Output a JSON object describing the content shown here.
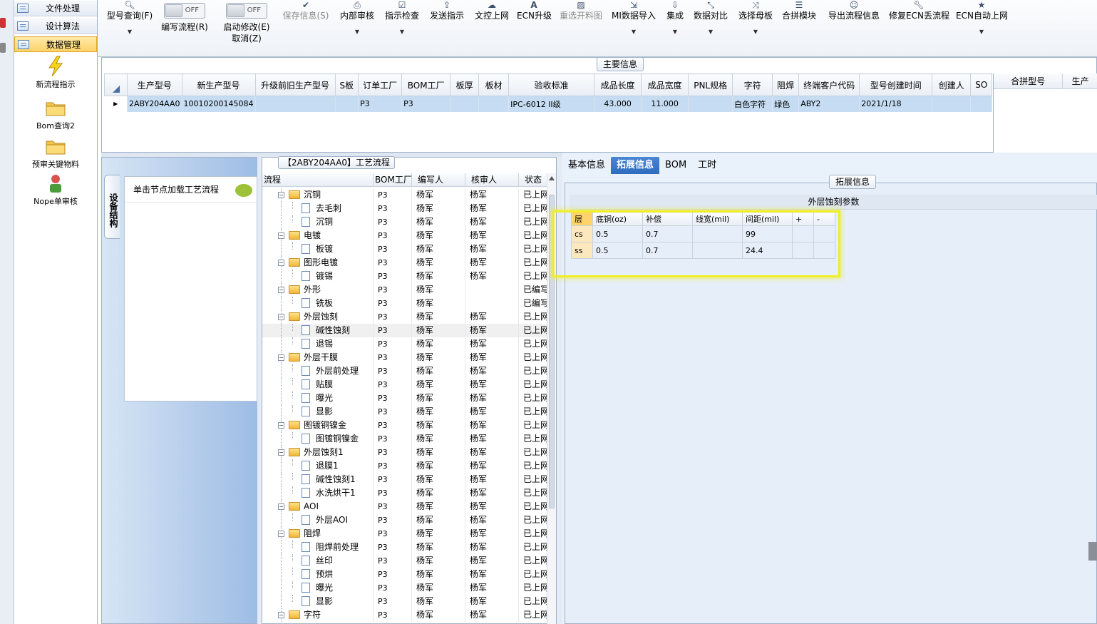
{
  "nav": {
    "items": [
      {
        "label": "文件处理",
        "icon": "list-icon"
      },
      {
        "label": "设计算法",
        "icon": "list-icon"
      },
      {
        "label": "数据管理",
        "icon": "list-icon",
        "active": true
      }
    ],
    "big_items": [
      {
        "label": "新流程指示",
        "icon": "lightning-icon"
      },
      {
        "label": "Bom查询2",
        "icon": "folder-icon"
      },
      {
        "label": "预审关键物料",
        "icon": "folder-icon"
      },
      {
        "label": "Nope单审核",
        "icon": "person-icon"
      }
    ]
  },
  "toolbar": {
    "model_query": "型号查询(F)",
    "edit_flow": "编写流程(R)",
    "edit_flow_toggle": "OFF",
    "start_modify": "启动修改(E)",
    "start_modify_toggle": "OFF",
    "cancel": "取消(Z)",
    "save_info": "保存信息(S)",
    "internal_audit": "内部审核",
    "instruction_check": "指示检查",
    "send_instruction": "发送指示",
    "doc_control_online": "文控上网",
    "ecn_upgrade": "ECN升级",
    "reselect_cutting": "重选开料图",
    "mi_import": "MI数据导入",
    "integrate": "集成",
    "data_compare": "数据对比",
    "select_master": "选择母板",
    "merge_module": "合拼模块",
    "export_flow": "导出流程信息",
    "repair_ecn": "修复ECN丢流程",
    "ecn_auto_online": "ECN自动上网"
  },
  "main_info": {
    "title": "主要信息",
    "columns": [
      "生产型号",
      "新生产型号",
      "升级前旧生产型号",
      "S板",
      "订单工厂",
      "BOM工厂",
      "板厚",
      "板材",
      "验收标准",
      "成品长度",
      "成品宽度",
      "PNL规格",
      "字符",
      "阻焊",
      "终端客户代码",
      "型号创建时间",
      "创建人",
      "SO"
    ],
    "row": [
      "2ABY204AA0",
      "10010200145084",
      "",
      "",
      "P3",
      "P3",
      "",
      "",
      "IPC-6012 II级",
      "43.000",
      "11.000",
      "",
      "白色字符",
      "绿色",
      "ABY2",
      "2021/1/18",
      "",
      ""
    ],
    "right_columns": [
      "合拼型号",
      "生产"
    ]
  },
  "left_panel": {
    "vertical_tab": "设备结构",
    "hint": "单击节点加载工艺流程"
  },
  "tree": {
    "title": "【2ABY204AA0】工艺流程",
    "columns": [
      "流程",
      "BOM工厂",
      "编写人",
      "核审人",
      "状态"
    ],
    "rows": [
      {
        "level": 0,
        "name": "沉铜",
        "bom": "P3",
        "writer": "杨军",
        "reviewer": "杨军",
        "status": "已上网"
      },
      {
        "level": 1,
        "name": "去毛刺",
        "bom": "P3",
        "writer": "杨军",
        "reviewer": "杨军",
        "status": "已上网"
      },
      {
        "level": 1,
        "name": "沉铜",
        "bom": "P3",
        "writer": "杨军",
        "reviewer": "杨军",
        "status": "已上网"
      },
      {
        "level": 0,
        "name": "电镀",
        "bom": "P3",
        "writer": "杨军",
        "reviewer": "杨军",
        "status": "已上网"
      },
      {
        "level": 1,
        "name": "板镀",
        "bom": "P3",
        "writer": "杨军",
        "reviewer": "杨军",
        "status": "已上网"
      },
      {
        "level": 0,
        "name": "图形电镀",
        "bom": "P3",
        "writer": "杨军",
        "reviewer": "杨军",
        "status": "已上网"
      },
      {
        "level": 1,
        "name": "镀锡",
        "bom": "P3",
        "writer": "杨军",
        "reviewer": "杨军",
        "status": "已上网"
      },
      {
        "level": 0,
        "name": "外形",
        "bom": "P3",
        "writer": "杨军",
        "reviewer": "",
        "status": "已编写"
      },
      {
        "level": 1,
        "name": "铣板",
        "bom": "P3",
        "writer": "杨军",
        "reviewer": "",
        "status": "已编写"
      },
      {
        "level": 0,
        "name": "外层蚀刻",
        "bom": "P3",
        "writer": "杨军",
        "reviewer": "杨军",
        "status": "已上网"
      },
      {
        "level": 1,
        "name": "碱性蚀刻",
        "bom": "P3",
        "writer": "杨军",
        "reviewer": "杨军",
        "status": "已上网",
        "selected": true
      },
      {
        "level": 1,
        "name": "退锡",
        "bom": "P3",
        "writer": "杨军",
        "reviewer": "杨军",
        "status": "已上网"
      },
      {
        "level": 0,
        "name": "外层干膜",
        "bom": "P3",
        "writer": "杨军",
        "reviewer": "杨军",
        "status": "已上网"
      },
      {
        "level": 1,
        "name": "外层前处理",
        "bom": "P3",
        "writer": "杨军",
        "reviewer": "杨军",
        "status": "已上网"
      },
      {
        "level": 1,
        "name": "贴膜",
        "bom": "P3",
        "writer": "杨军",
        "reviewer": "杨军",
        "status": "已上网"
      },
      {
        "level": 1,
        "name": "曝光",
        "bom": "P3",
        "writer": "杨军",
        "reviewer": "杨军",
        "status": "已上网"
      },
      {
        "level": 1,
        "name": "显影",
        "bom": "P3",
        "writer": "杨军",
        "reviewer": "杨军",
        "status": "已上网"
      },
      {
        "level": 0,
        "name": "图镀铜镍金",
        "bom": "P3",
        "writer": "杨军",
        "reviewer": "杨军",
        "status": "已上网"
      },
      {
        "level": 1,
        "name": "图镀铜镍金",
        "bom": "P3",
        "writer": "杨军",
        "reviewer": "杨军",
        "status": "已上网"
      },
      {
        "level": 0,
        "name": "外层蚀刻1",
        "bom": "P3",
        "writer": "杨军",
        "reviewer": "杨军",
        "status": "已上网"
      },
      {
        "level": 1,
        "name": "退膜1",
        "bom": "P3",
        "writer": "杨军",
        "reviewer": "杨军",
        "status": "已上网"
      },
      {
        "level": 1,
        "name": "碱性蚀刻1",
        "bom": "P3",
        "writer": "杨军",
        "reviewer": "杨军",
        "status": "已上网"
      },
      {
        "level": 1,
        "name": "水洗烘干1",
        "bom": "P3",
        "writer": "杨军",
        "reviewer": "杨军",
        "status": "已上网"
      },
      {
        "level": 0,
        "name": "AOI",
        "bom": "P3",
        "writer": "杨军",
        "reviewer": "杨军",
        "status": "已上网"
      },
      {
        "level": 1,
        "name": "外层AOI",
        "bom": "P3",
        "writer": "杨军",
        "reviewer": "杨军",
        "status": "已上网"
      },
      {
        "level": 0,
        "name": "阻焊",
        "bom": "P3",
        "writer": "杨军",
        "reviewer": "杨军",
        "status": "已上网"
      },
      {
        "level": 1,
        "name": "阻焊前处理",
        "bom": "P3",
        "writer": "杨军",
        "reviewer": "杨军",
        "status": "已上网"
      },
      {
        "level": 1,
        "name": "丝印",
        "bom": "P3",
        "writer": "杨军",
        "reviewer": "杨军",
        "status": "已上网"
      },
      {
        "level": 1,
        "name": "预烘",
        "bom": "P3",
        "writer": "杨军",
        "reviewer": "杨军",
        "status": "已上网"
      },
      {
        "level": 1,
        "name": "曝光",
        "bom": "P3",
        "writer": "杨军",
        "reviewer": "杨军",
        "status": "已上网"
      },
      {
        "level": 1,
        "name": "显影",
        "bom": "P3",
        "writer": "杨军",
        "reviewer": "杨军",
        "status": "已上网"
      },
      {
        "level": 0,
        "name": "字符",
        "bom": "P3",
        "writer": "杨军",
        "reviewer": "杨军",
        "status": "已上网"
      }
    ]
  },
  "detail_tabs": [
    "基本信息",
    "拓展信息",
    "BOM",
    "工时"
  ],
  "active_tab": 1,
  "ext_info": {
    "title": "拓展信息",
    "etch_title": "外层蚀刻参数",
    "columns": [
      "层",
      "底铜(oz)",
      "补偿",
      "线宽(mil)",
      "间距(mil)",
      "+",
      "-"
    ],
    "rows": [
      [
        "cs",
        "0.5",
        "0.7",
        "",
        "99",
        "",
        ""
      ],
      [
        "ss",
        "0.5",
        "0.7",
        "",
        "24.4",
        "",
        ""
      ]
    ]
  }
}
